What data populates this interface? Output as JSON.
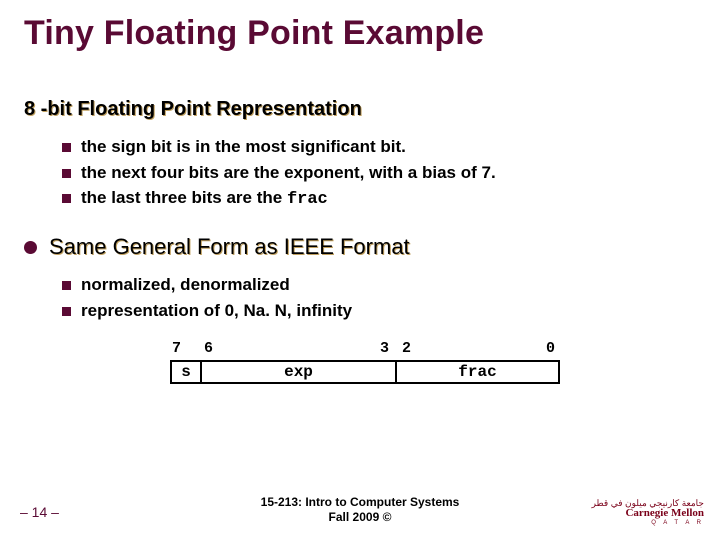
{
  "title": "Tiny Floating Point Example",
  "subhead": "8 -bit Floating Point Representation",
  "rep_items": {
    "a": "the sign bit is in the most significant bit.",
    "b": "the next four bits are the exponent, with a bias of 7.",
    "c_prefix": "the last three bits are the ",
    "c_mono": "frac"
  },
  "section2": "Same General Form as IEEE Format",
  "form_items": {
    "a": "normalized, denormalized",
    "b": "representation of 0, Na. N, infinity"
  },
  "diagram": {
    "bit7": "7",
    "bit6": "6",
    "bit3": "3",
    "bit2": "2",
    "bit0": "0",
    "s": "s",
    "exp": "exp",
    "frac": "frac"
  },
  "footer": {
    "page": "– 14 –",
    "course_l1": "15-213: Intro to Computer Systems",
    "course_l2": "Fall 2009 ©",
    "logo_ar": "جامعة كارنيجي ميلون في قطر",
    "logo_en": "Carnegie Mellon",
    "logo_q": "Q A T A R"
  }
}
